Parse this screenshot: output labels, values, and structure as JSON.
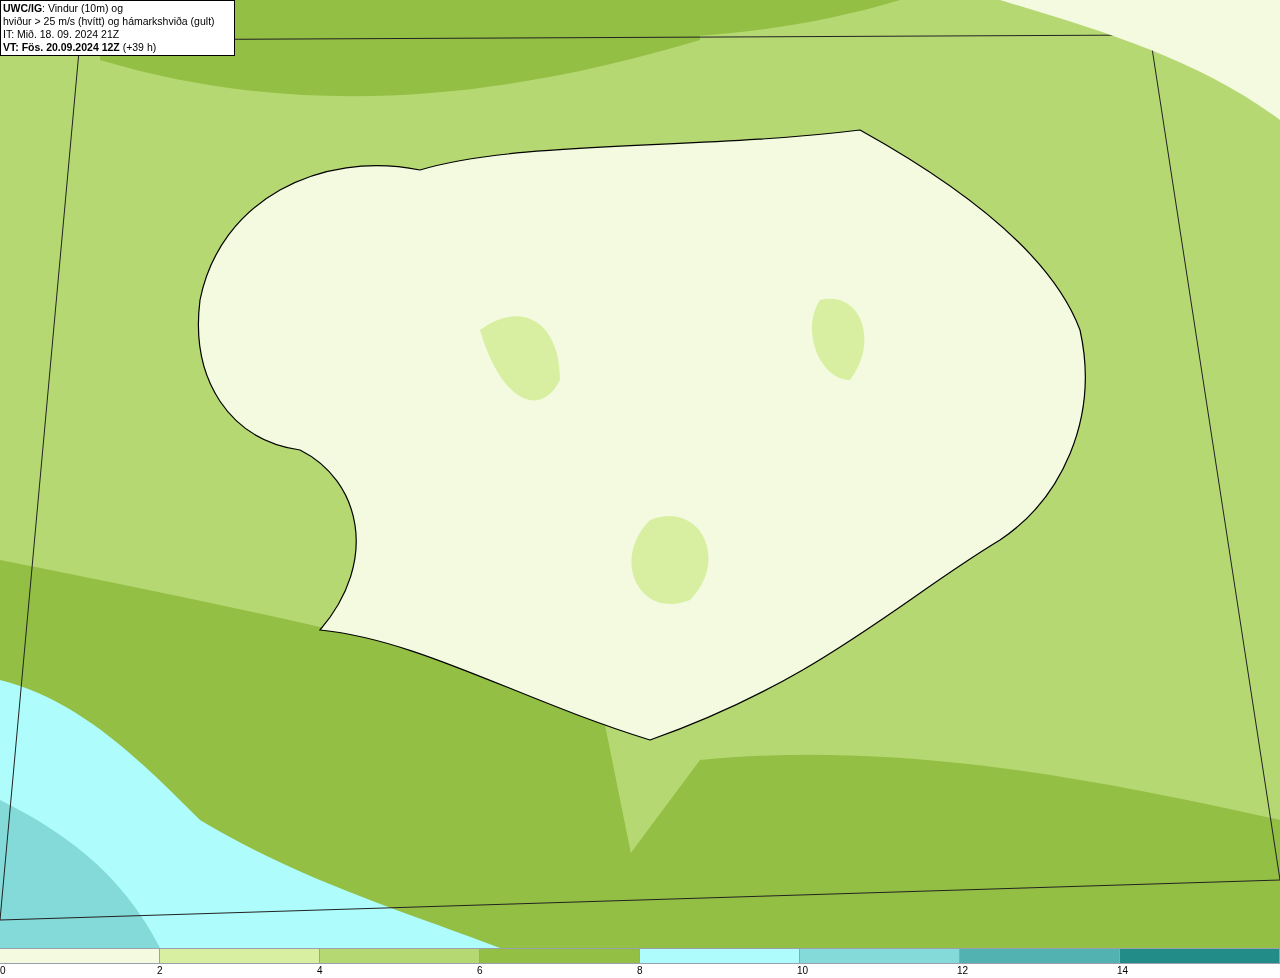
{
  "caption": {
    "lines": [
      "**UWC/IG**: Vindur (10m) og",
      "hviður > 25 m/s (hvítt) og hámarkshviða (gult)",
      "IT: Mið. 18. 09. 2024 21Z",
      "**VT: Fös. 20.09.2024 12Z** (+39 h)"
    ]
  },
  "legend": {
    "bins": [
      {
        "color": "#f3fadf"
      },
      {
        "color": "#d8efa2"
      },
      {
        "color": "#b6d873"
      },
      {
        "color": "#93bf45"
      },
      {
        "color": "#aefcfc"
      },
      {
        "color": "#84d9d9"
      },
      {
        "color": "#52b1b1"
      },
      {
        "color": "#228d88"
      }
    ],
    "ticks": [
      "0",
      "2",
      "4",
      "6",
      "8",
      "10",
      "12",
      "14"
    ]
  }
}
